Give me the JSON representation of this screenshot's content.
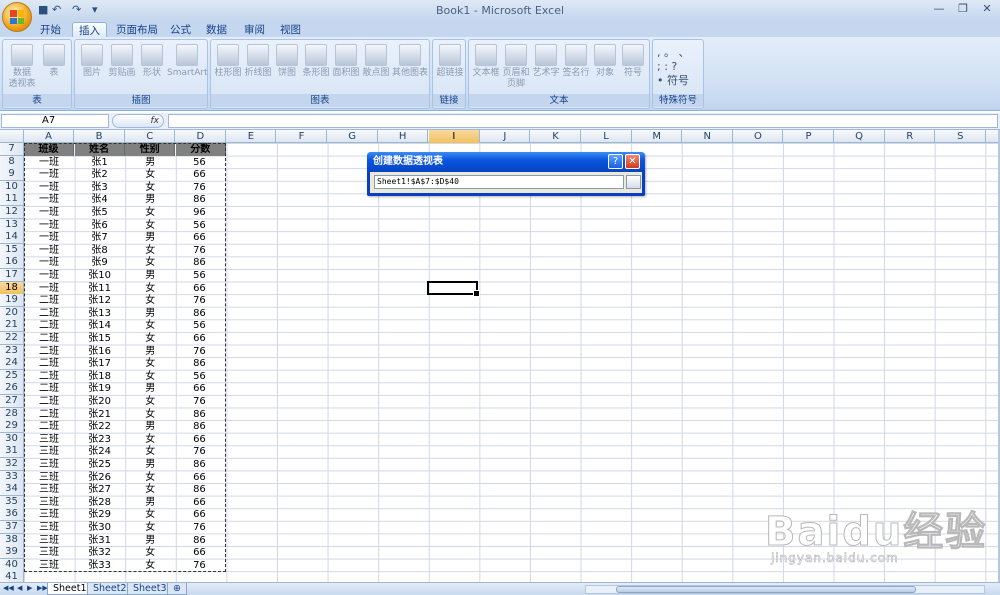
{
  "app": {
    "title": "Book1 - Microsoft Excel",
    "undo": "↶",
    "redo": "↷"
  },
  "tabs": [
    "开始",
    "插入",
    "页面布局",
    "公式",
    "数据",
    "审阅",
    "视图"
  ],
  "active_tab": "插入",
  "ribbon": {
    "groups": [
      {
        "label": "表",
        "buttons": [
          "数据\n透视表",
          "表"
        ]
      },
      {
        "label": "插图",
        "buttons": [
          "图片",
          "剪贴画",
          "形状",
          "SmartArt"
        ]
      },
      {
        "label": "图表",
        "buttons": [
          "柱形图",
          "折线图",
          "饼图",
          "条形图",
          "面积图",
          "散点图",
          "其他图表"
        ]
      },
      {
        "label": "链接",
        "buttons": [
          "超链接"
        ]
      },
      {
        "label": "文本",
        "buttons": [
          "文本框",
          "页眉和\n页脚",
          "艺术字",
          "签名行",
          "对象",
          "符号"
        ]
      },
      {
        "label": "特殊符号",
        "buttons": []
      }
    ],
    "special_symbols": ", 。 、\n; : ?\n• 符号"
  },
  "formula_bar": {
    "name_box": "A7",
    "fx": "fx",
    "formula": ""
  },
  "columns": [
    "A",
    "B",
    "C",
    "D",
    "E",
    "F",
    "G",
    "H",
    "I",
    "J",
    "K",
    "L",
    "M",
    "N",
    "O",
    "P",
    "Q",
    "R",
    "S"
  ],
  "selected_column": "I",
  "selected_row": "18",
  "row_numbers": [
    "7",
    "8",
    "9",
    "10",
    "11",
    "12",
    "13",
    "14",
    "15",
    "16",
    "17",
    "18",
    "19",
    "20",
    "21",
    "22",
    "23",
    "24",
    "25",
    "26",
    "27",
    "28",
    "29",
    "30",
    "31",
    "32",
    "33",
    "34",
    "35",
    "36",
    "37",
    "38",
    "39",
    "40",
    "41"
  ],
  "table": {
    "headers": [
      "班级",
      "姓名",
      "性别",
      "分数"
    ],
    "rows": [
      [
        "一班",
        "张1",
        "男",
        "56"
      ],
      [
        "一班",
        "张2",
        "女",
        "66"
      ],
      [
        "一班",
        "张3",
        "女",
        "76"
      ],
      [
        "一班",
        "张4",
        "男",
        "86"
      ],
      [
        "一班",
        "张5",
        "女",
        "96"
      ],
      [
        "一班",
        "张6",
        "女",
        "56"
      ],
      [
        "一班",
        "张7",
        "男",
        "66"
      ],
      [
        "一班",
        "张8",
        "女",
        "76"
      ],
      [
        "一班",
        "张9",
        "女",
        "86"
      ],
      [
        "一班",
        "张10",
        "男",
        "56"
      ],
      [
        "一班",
        "张11",
        "女",
        "66"
      ],
      [
        "二班",
        "张12",
        "女",
        "76"
      ],
      [
        "二班",
        "张13",
        "男",
        "86"
      ],
      [
        "二班",
        "张14",
        "女",
        "56"
      ],
      [
        "二班",
        "张15",
        "女",
        "66"
      ],
      [
        "二班",
        "张16",
        "男",
        "76"
      ],
      [
        "二班",
        "张17",
        "女",
        "86"
      ],
      [
        "二班",
        "张18",
        "女",
        "56"
      ],
      [
        "二班",
        "张19",
        "男",
        "66"
      ],
      [
        "二班",
        "张20",
        "女",
        "76"
      ],
      [
        "二班",
        "张21",
        "女",
        "86"
      ],
      [
        "二班",
        "张22",
        "男",
        "86"
      ],
      [
        "三班",
        "张23",
        "女",
        "66"
      ],
      [
        "三班",
        "张24",
        "女",
        "76"
      ],
      [
        "三班",
        "张25",
        "男",
        "86"
      ],
      [
        "三班",
        "张26",
        "女",
        "66"
      ],
      [
        "三班",
        "张27",
        "女",
        "86"
      ],
      [
        "三班",
        "张28",
        "男",
        "66"
      ],
      [
        "三班",
        "张29",
        "女",
        "66"
      ],
      [
        "三班",
        "张30",
        "女",
        "76"
      ],
      [
        "三班",
        "张31",
        "男",
        "86"
      ],
      [
        "三班",
        "张32",
        "女",
        "66"
      ],
      [
        "三班",
        "张33",
        "女",
        "76"
      ]
    ]
  },
  "dialog": {
    "title": "创建数据透视表",
    "help": "?",
    "close": "✕",
    "range": "Sheet1!$A$7:$D$40"
  },
  "sheets": [
    "Sheet1",
    "Sheet2",
    "Sheet3"
  ],
  "active_sheet": "Sheet1",
  "watermark": {
    "text": "Baidu经验",
    "url": "jingyan.baidu.com"
  },
  "colors": {
    "ribbon_bg": "#cfdff3",
    "header_fill": "#808080",
    "dialog_title": "#0a56e0",
    "selection": "#f1c15f"
  }
}
